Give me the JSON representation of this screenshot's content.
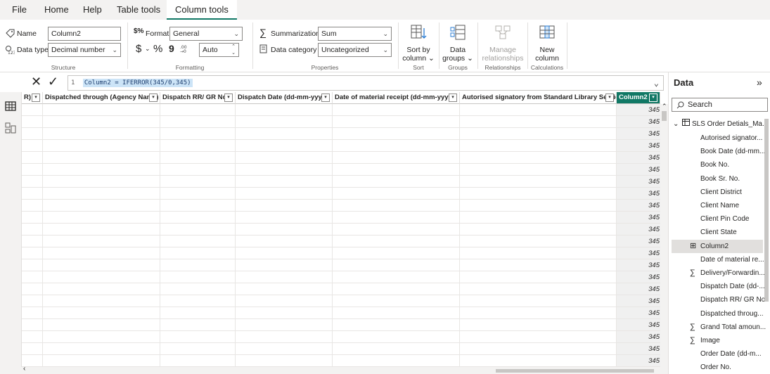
{
  "menu": {
    "items": [
      "File",
      "Home",
      "Help",
      "Table tools",
      "Column tools"
    ],
    "active": "Column tools"
  },
  "ribbon": {
    "structure": {
      "name_label": "Name",
      "name_value": "Column2",
      "datatype_label": "Data type",
      "datatype_value": "Decimal number",
      "group_label": "Structure"
    },
    "formatting": {
      "format_label": "Format",
      "format_value": "General",
      "currency_symbol": "$",
      "percent_symbol": "%",
      "comma_symbol": "9",
      "decimals_value": "Auto",
      "group_label": "Formatting"
    },
    "properties": {
      "summarization_label": "Summarization",
      "summarization_value": "Sum",
      "category_label": "Data category",
      "category_value": "Uncategorized",
      "group_label": "Properties"
    },
    "sort": {
      "button_line1": "Sort by",
      "button_line2": "column",
      "group_label": "Sort"
    },
    "groups": {
      "button_line1": "Data",
      "button_line2": "groups",
      "group_label": "Groups"
    },
    "relationships": {
      "button_line1": "Manage",
      "button_line2": "relationships",
      "group_label": "Relationships"
    },
    "calculations": {
      "button_line1": "New",
      "button_line2": "column",
      "group_label": "Calculations"
    }
  },
  "formula": {
    "line_number": "1",
    "text": "Column2 = IFERROR(345/0,345)"
  },
  "table": {
    "columns": [
      {
        "label": "R)"
      },
      {
        "label": "Dispatched through (Agency Name)"
      },
      {
        "label": "Dispatch RR/ GR No."
      },
      {
        "label": "Dispatch Date (dd-mm-yyyy)"
      },
      {
        "label": "Date  of material receipt (dd-mm-yyyy)"
      },
      {
        "label": "Autorised signatory from Standard Library Service"
      },
      {
        "label": "Column2"
      }
    ],
    "cell_value": "345"
  },
  "data_pane": {
    "title": "Data",
    "search_placeholder": "Search",
    "table_name": "SLS Order Detials_Ma...",
    "fields": [
      {
        "label": "Autorised signator...",
        "icon": ""
      },
      {
        "label": "Book Date (dd-mm...",
        "icon": ""
      },
      {
        "label": "Book No.",
        "icon": ""
      },
      {
        "label": "Book Sr. No.",
        "icon": ""
      },
      {
        "label": "Client District",
        "icon": ""
      },
      {
        "label": "Client Name",
        "icon": ""
      },
      {
        "label": "Client Pin Code",
        "icon": ""
      },
      {
        "label": "Client State",
        "icon": ""
      },
      {
        "label": "Column2",
        "icon": "calc-column-icon"
      },
      {
        "label": "Date of material re...",
        "icon": ""
      },
      {
        "label": "Delivery/Forwardin...",
        "icon": "sigma-icon"
      },
      {
        "label": "Dispatch Date (dd-...",
        "icon": ""
      },
      {
        "label": "Dispatch RR/ GR No.",
        "icon": ""
      },
      {
        "label": "Dispatched throug...",
        "icon": ""
      },
      {
        "label": "Grand Total amoun...",
        "icon": "sigma-icon"
      },
      {
        "label": "Image",
        "icon": "sigma-icon"
      },
      {
        "label": "Order Date (dd-m...",
        "icon": ""
      },
      {
        "label": "Order No.",
        "icon": ""
      }
    ]
  },
  "colors": {
    "accent": "#117865",
    "selected_field_bg": "#e1dfdd"
  }
}
